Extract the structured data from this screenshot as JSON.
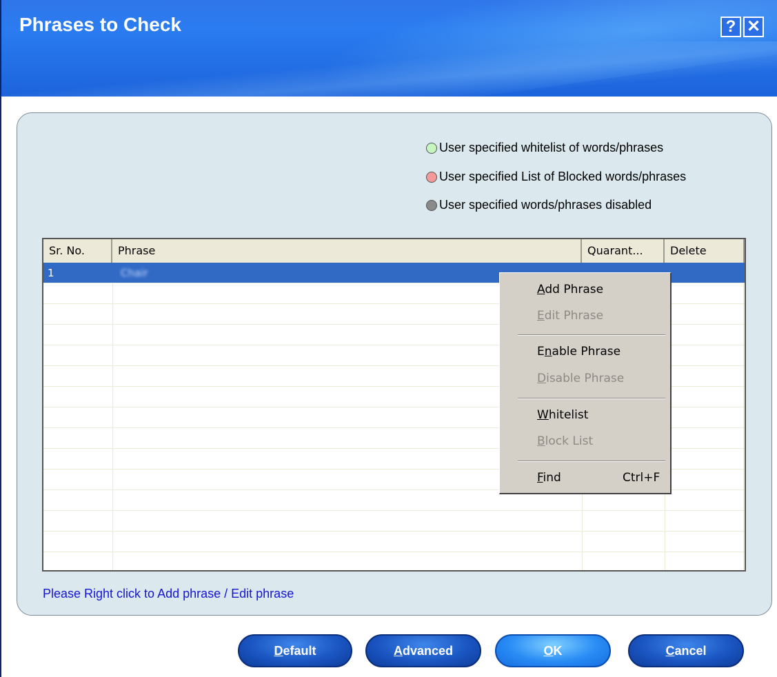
{
  "window": {
    "title": "Phrases to Check",
    "help_button": "?",
    "close_button": "✕"
  },
  "legend": [
    {
      "label": "User specified whitelist of words/phrases",
      "color": "#c7f5c0"
    },
    {
      "label": "User specified List of Blocked words/phrases",
      "color": "#f59a9a"
    },
    {
      "label": "User specified words/phrases disabled",
      "color": "#8a8a8a"
    }
  ],
  "table": {
    "columns": [
      "Sr. No.",
      "Phrase",
      "Quarant...",
      "Delete"
    ],
    "rows": [
      {
        "sr_no": "1",
        "phrase": "Chair",
        "selected": true
      }
    ],
    "empty_rows": 14
  },
  "context_menu": {
    "items": [
      {
        "pre": "",
        "accel": "A",
        "post": "dd Phrase",
        "enabled": true
      },
      {
        "pre": "",
        "accel": "E",
        "post": "dit Phrase",
        "enabled": false
      },
      {
        "pre": "E",
        "accel": "n",
        "post": "able Phrase",
        "enabled": true
      },
      {
        "pre": "",
        "accel": "D",
        "post": "isable Phrase",
        "enabled": false
      },
      {
        "pre": "",
        "accel": "W",
        "post": "hitelist",
        "enabled": true
      },
      {
        "pre": "",
        "accel": "B",
        "post": "lock List",
        "enabled": false
      },
      {
        "pre": "",
        "accel": "F",
        "post": "ind",
        "enabled": true,
        "shortcut": "Ctrl+F"
      }
    ]
  },
  "hint": "Please Right click to Add phrase / Edit phrase",
  "buttons": {
    "default": {
      "accel": "D",
      "rest": "efault"
    },
    "advanced": {
      "accel": "A",
      "rest": "dvanced"
    },
    "ok": {
      "accel": "O",
      "rest": "K"
    },
    "cancel": {
      "accel": "C",
      "rest": "ancel"
    }
  }
}
